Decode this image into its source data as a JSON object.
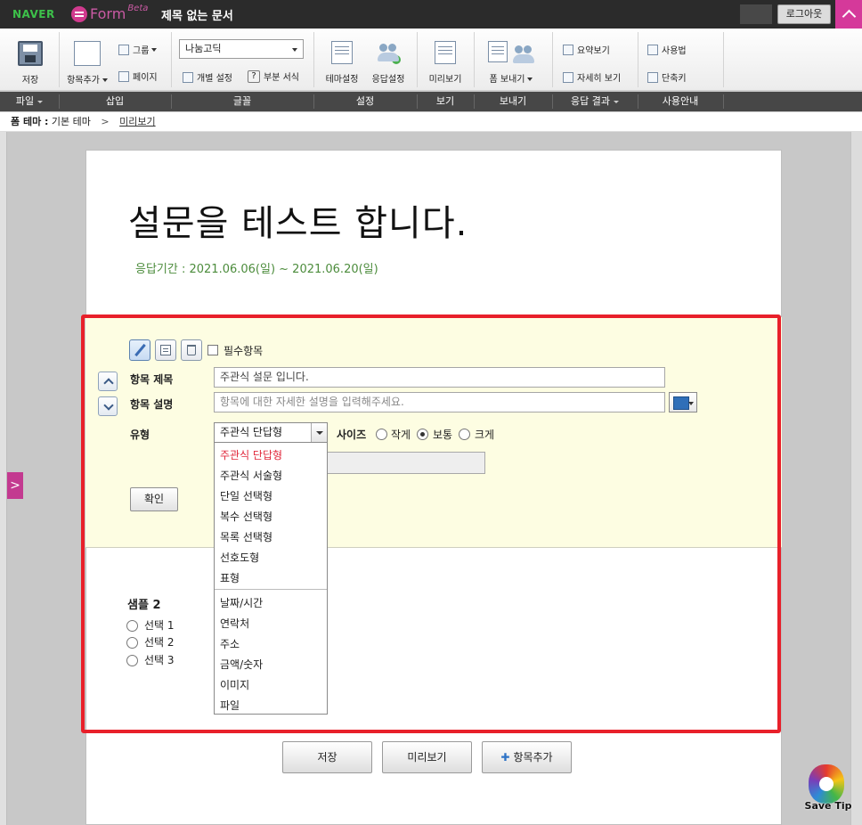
{
  "topbar": {
    "naver": "NAVER",
    "app_name": "Form",
    "beta": "Beta",
    "document_title": "제목 없는 문서",
    "logout": "로그아웃"
  },
  "ribbon": {
    "save": "저장",
    "add_item": "항목추가",
    "group": "그룹",
    "page": "페이지",
    "font_name": "나눔고딕",
    "individual_setting": "개별 설정",
    "partial_format": "부분 서식",
    "theme_setting": "테마설정",
    "response_setting": "응답설정",
    "preview": "미리보기",
    "send_form": "폼 보내기",
    "summary_view": "요약보기",
    "detail_view": "자세히 보기",
    "usage": "사용법",
    "shortcut": "단축키"
  },
  "groups": [
    "파일",
    "삽입",
    "글꼴",
    "설정",
    "보기",
    "보내기",
    "응답 결과",
    "사용안내"
  ],
  "breadcrumb": {
    "label": "폼 테마 :",
    "theme": "기본 테마",
    "sep": ">",
    "preview": "미리보기"
  },
  "form": {
    "title": "설문을 테스트 합니다.",
    "period": "응답기간 : 2021.06.06(일) ~ 2021.06.20(일)"
  },
  "editor": {
    "required": "필수항목",
    "item_title_label": "항목 제목",
    "item_title_value": "주관식 설문 입니다.",
    "item_desc_label": "항목 설명",
    "item_desc_placeholder": "항목에 대한 자세한 설명을 입력해주세요.",
    "type_label": "유형",
    "type_value": "주관식 단답형",
    "size_label": "사이즈",
    "size_small": "작게",
    "size_normal": "보통",
    "size_large": "크게",
    "selected_size": "보통",
    "confirm": "확인"
  },
  "dropdown": {
    "options_top": [
      "주관식 단답형",
      "주관식 서술형",
      "단일 선택형",
      "복수 선택형",
      "목록 선택형",
      "선호도형",
      "표형"
    ],
    "options_bottom": [
      "날짜/시간",
      "연락처",
      "주소",
      "금액/숫자",
      "이미지",
      "파일"
    ],
    "selected": "주관식 단답형"
  },
  "sample": {
    "title": "샘플 2",
    "options": [
      "선택 1",
      "선택 2",
      "선택 3"
    ]
  },
  "bottom": {
    "save": "저장",
    "preview": "미리보기",
    "add_item": "항목추가"
  },
  "watermark": "Save Tip",
  "colors": {
    "accent": "#d5399a",
    "highlight_border": "#e8202a",
    "edit_bg": "#fdfde2",
    "period_text": "#4c8c3c"
  }
}
